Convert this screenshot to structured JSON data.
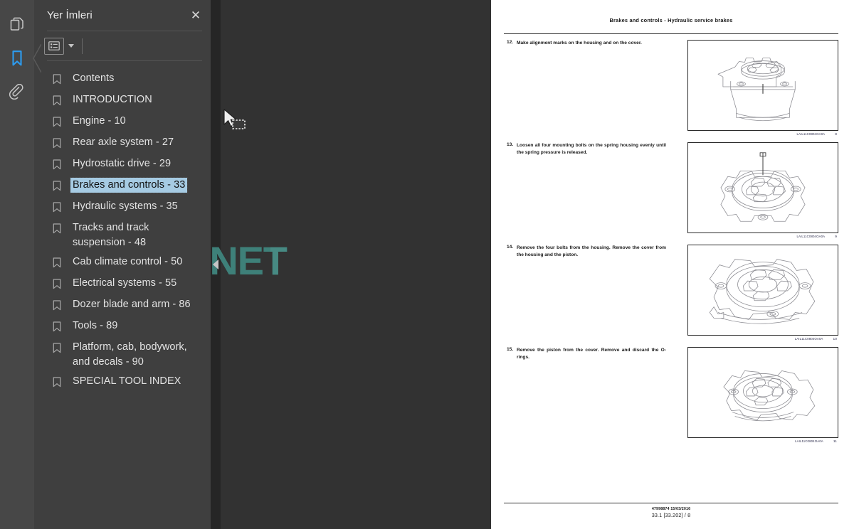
{
  "app": {
    "rail": [
      {
        "name": "page-thumbnails-icon",
        "label": "Sayfa Küçük Resimleri",
        "active": false
      },
      {
        "name": "bookmarks-icon",
        "label": "Yer İmleri",
        "active": true
      },
      {
        "name": "attachments-icon",
        "label": "Ekler",
        "active": false
      }
    ]
  },
  "panel": {
    "title": "Yer İmleri",
    "close_label": "✕",
    "options_label": "Seçenekler",
    "collapse_label": "◀"
  },
  "bookmarks": [
    {
      "label": "Contents",
      "selected": false
    },
    {
      "label": "INTRODUCTION",
      "selected": false
    },
    {
      "label": "Engine - 10",
      "selected": false
    },
    {
      "label": "Rear axle system - 27",
      "selected": false
    },
    {
      "label": "Hydrostatic drive - 29",
      "selected": false
    },
    {
      "label": "Brakes and controls - 33",
      "selected": true
    },
    {
      "label": "Hydraulic systems - 35",
      "selected": false
    },
    {
      "label": "Tracks and track suspension - 48",
      "selected": false
    },
    {
      "label": "Cab climate control - 50",
      "selected": false
    },
    {
      "label": "Electrical systems - 55",
      "selected": false
    },
    {
      "label": "Dozer blade and arm - 86",
      "selected": false
    },
    {
      "label": "Tools - 89",
      "selected": false
    },
    {
      "label": "Platform, cab, bodywork, and decals - 90",
      "selected": false
    },
    {
      "label": "SPECIAL TOOL INDEX",
      "selected": false
    }
  ],
  "document": {
    "header": "Brakes and controls - Hydraulic service brakes",
    "steps": [
      {
        "number": "12.",
        "text": "Make alignment marks on the housing and on the cover.",
        "figure_code": "LAIL11C0804OA0A",
        "figure_number": "8"
      },
      {
        "number": "13.",
        "text": "Loosen all four mounting bolts on the spring housing evenly until the spring pressure is released.",
        "figure_code": "LAIL11C0804OA0A",
        "figure_number": "9"
      },
      {
        "number": "14.",
        "text": "Remove the four bolts from the housing. Remove the cover from the housing and the piston.",
        "figure_code": "LAIL11C0804OA0A",
        "figure_number": "10"
      },
      {
        "number": "15.",
        "text": "Remove the piston from the cover. Remove and discard the O-rings.",
        "figure_code": "LAIL11C0804OA0A",
        "figure_number": "11"
      }
    ],
    "footer_code": "47998874 15/03/2016",
    "footer_page": "33.1 [33.202] / 8"
  },
  "watermark": {
    "text": "AUTOPDF.NET",
    "color": "#3e8079"
  },
  "colors": {
    "rail_bg": "#474747",
    "panel_bg": "#3f3f3f",
    "viewer_bg": "#323232",
    "accent": "#2d9cf0",
    "selection": "#a6cbe3"
  }
}
